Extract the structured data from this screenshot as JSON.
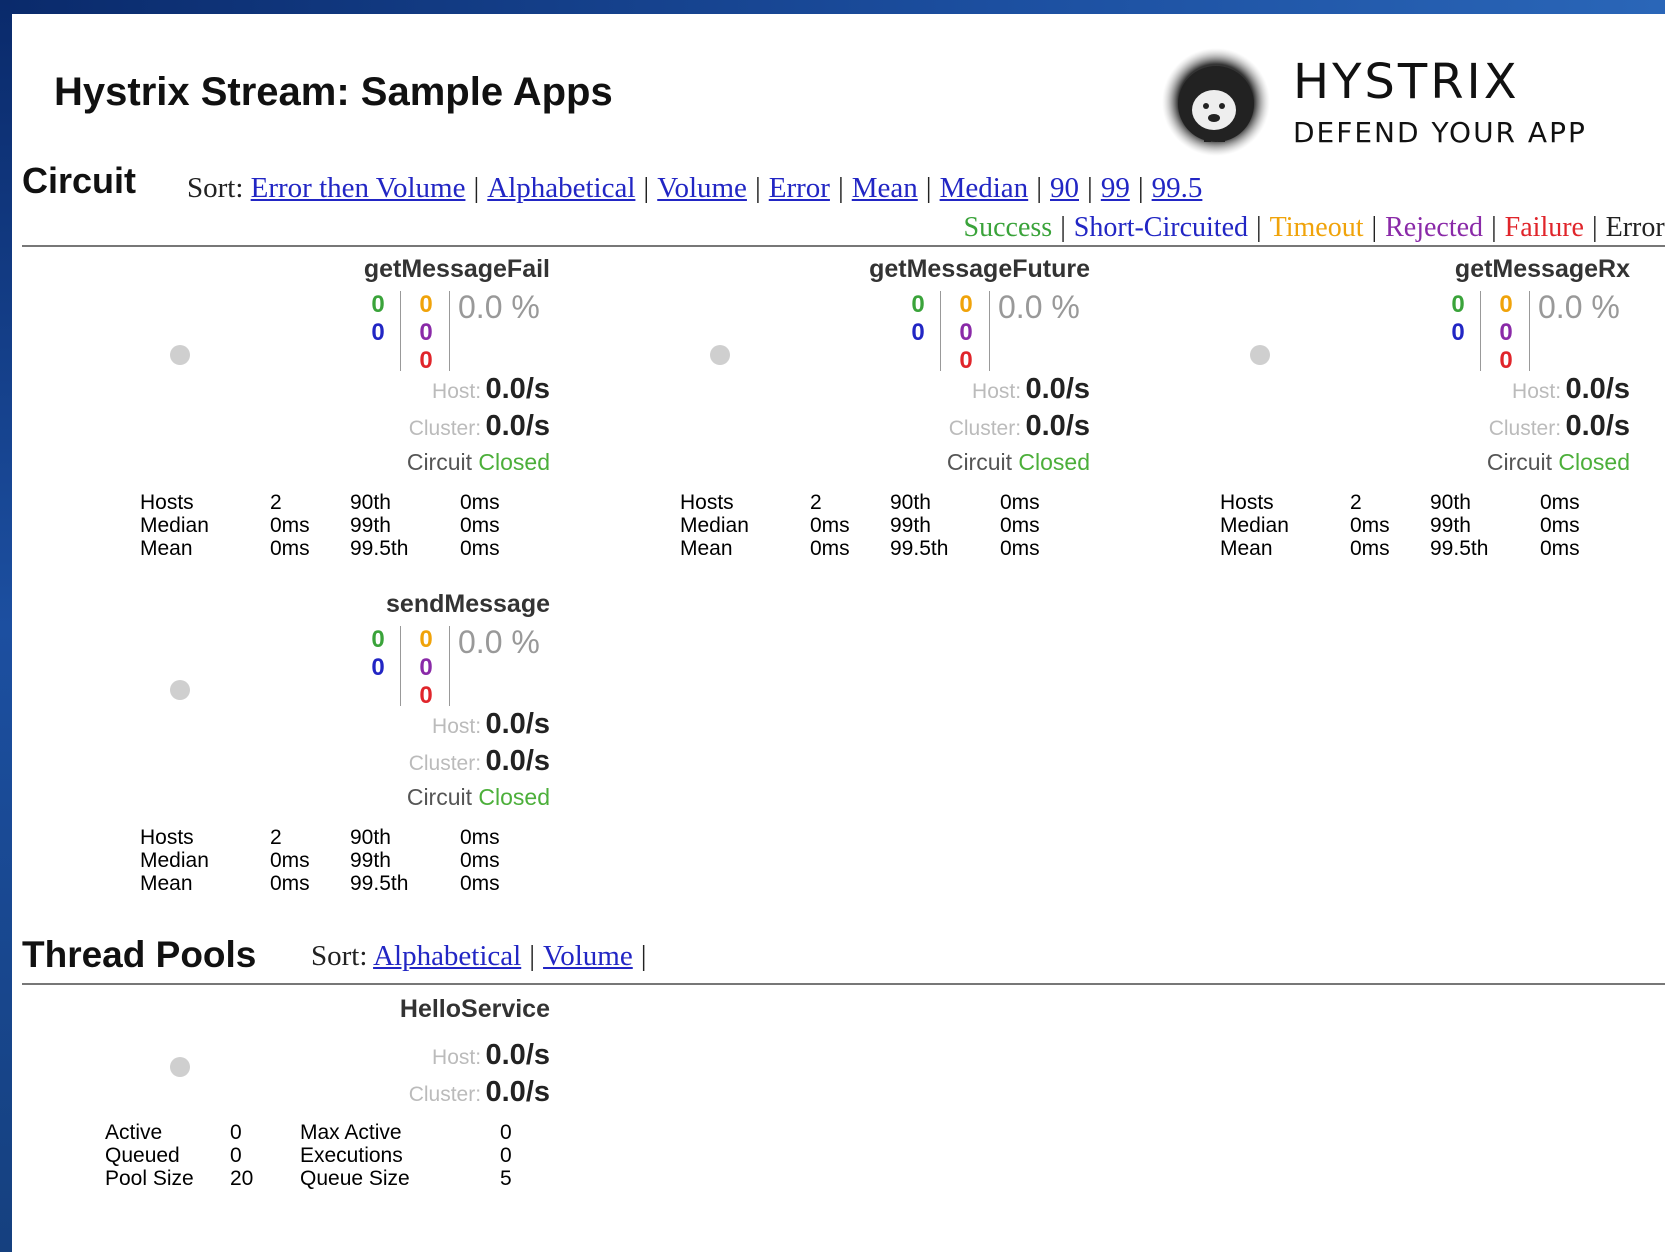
{
  "page": {
    "title": "Hystrix Stream: Sample Apps"
  },
  "logo": {
    "name": "HYSTRIX",
    "tagline": "DEFEND YOUR APP"
  },
  "colors": {
    "success": "#3aa33a",
    "short_circuited": "#2226c4",
    "timeout": "#f0a30a",
    "rejected": "#8a2aa8",
    "failure": "#e0252b",
    "closed": "#4caf3a",
    "link": "#2226c4"
  },
  "circuit": {
    "title": "Circuit",
    "sort_label": "Sort:",
    "sort_options": [
      "Error then Volume",
      "Alphabetical",
      "Volume",
      "Error",
      "Mean",
      "Median",
      "90",
      "99",
      "99.5"
    ],
    "legend": [
      "Success",
      "Short-Circuited",
      "Timeout",
      "Rejected",
      "Failure",
      "Error %"
    ],
    "cards": [
      {
        "name": "getMessageFail",
        "success": "0",
        "short_circuited": "0",
        "timeout": "0",
        "rejected": "0",
        "failure": "0",
        "error_pct": "0.0 %",
        "host_label": "Host:",
        "host_rate": "0.0/s",
        "cluster_label": "Cluster:",
        "cluster_rate": "0.0/s",
        "circuit_label": "Circuit",
        "circuit_status": "Closed",
        "stats": {
          "hosts_label": "Hosts",
          "hosts": "2",
          "median_label": "Median",
          "median": "0ms",
          "mean_label": "Mean",
          "mean": "0ms",
          "p90_label": "90th",
          "p90": "0ms",
          "p99_label": "99th",
          "p99": "0ms",
          "p995_label": "99.5th",
          "p995": "0ms"
        }
      },
      {
        "name": "getMessageFuture",
        "success": "0",
        "short_circuited": "0",
        "timeout": "0",
        "rejected": "0",
        "failure": "0",
        "error_pct": "0.0 %",
        "host_label": "Host:",
        "host_rate": "0.0/s",
        "cluster_label": "Cluster:",
        "cluster_rate": "0.0/s",
        "circuit_label": "Circuit",
        "circuit_status": "Closed",
        "stats": {
          "hosts_label": "Hosts",
          "hosts": "2",
          "median_label": "Median",
          "median": "0ms",
          "mean_label": "Mean",
          "mean": "0ms",
          "p90_label": "90th",
          "p90": "0ms",
          "p99_label": "99th",
          "p99": "0ms",
          "p995_label": "99.5th",
          "p995": "0ms"
        }
      },
      {
        "name": "getMessageRx",
        "success": "0",
        "short_circuited": "0",
        "timeout": "0",
        "rejected": "0",
        "failure": "0",
        "error_pct": "0.0 %",
        "host_label": "Host:",
        "host_rate": "0.0/s",
        "cluster_label": "Cluster:",
        "cluster_rate": "0.0/s",
        "circuit_label": "Circuit",
        "circuit_status": "Closed",
        "stats": {
          "hosts_label": "Hosts",
          "hosts": "2",
          "median_label": "Median",
          "median": "0ms",
          "mean_label": "Mean",
          "mean": "0ms",
          "p90_label": "90th",
          "p90": "0ms",
          "p99_label": "99th",
          "p99": "0ms",
          "p995_label": "99.5th",
          "p995": "0ms"
        }
      },
      {
        "name": "sendMessage",
        "success": "0",
        "short_circuited": "0",
        "timeout": "0",
        "rejected": "0",
        "failure": "0",
        "error_pct": "0.0 %",
        "host_label": "Host:",
        "host_rate": "0.0/s",
        "cluster_label": "Cluster:",
        "cluster_rate": "0.0/s",
        "circuit_label": "Circuit",
        "circuit_status": "Closed",
        "stats": {
          "hosts_label": "Hosts",
          "hosts": "2",
          "median_label": "Median",
          "median": "0ms",
          "mean_label": "Mean",
          "mean": "0ms",
          "p90_label": "90th",
          "p90": "0ms",
          "p99_label": "99th",
          "p99": "0ms",
          "p995_label": "99.5th",
          "p995": "0ms"
        }
      }
    ]
  },
  "thread_pools": {
    "title": "Thread Pools",
    "sort_label": "Sort:",
    "sort_options": [
      "Alphabetical",
      "Volume"
    ],
    "pools": [
      {
        "name": "HelloService",
        "host_label": "Host:",
        "host_rate": "0.0/s",
        "cluster_label": "Cluster:",
        "cluster_rate": "0.0/s",
        "stats": {
          "active_label": "Active",
          "active": "0",
          "queued_label": "Queued",
          "queued": "0",
          "pool_size_label": "Pool Size",
          "pool_size": "20",
          "max_active_label": "Max Active",
          "max_active": "0",
          "executions_label": "Executions",
          "executions": "0",
          "queue_size_label": "Queue Size",
          "queue_size": "5"
        }
      }
    ]
  }
}
